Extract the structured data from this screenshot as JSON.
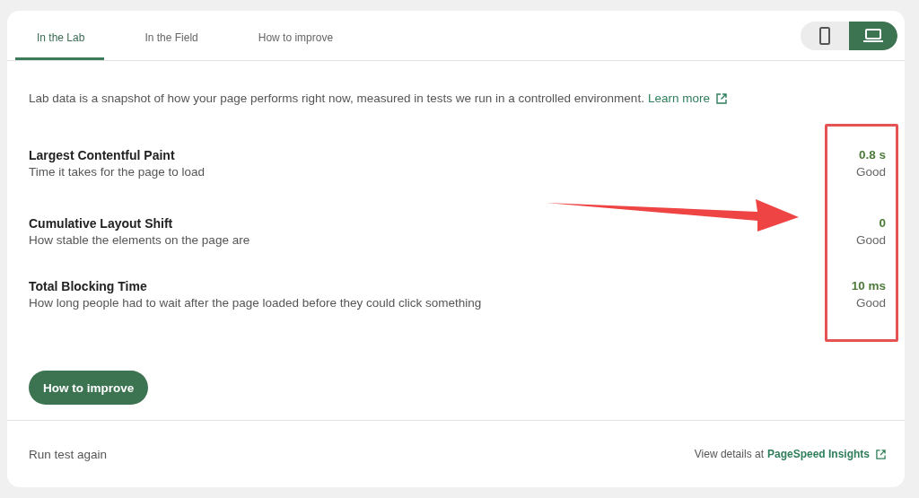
{
  "tabs": [
    {
      "label": "In the Lab",
      "selected": true
    },
    {
      "label": "In the Field",
      "selected": false
    },
    {
      "label": "How to improve",
      "selected": false
    }
  ],
  "device_toggle": [
    {
      "kind": "mobile",
      "selected": false
    },
    {
      "kind": "desktop",
      "selected": true
    }
  ],
  "intro": {
    "text": "Lab data is a snapshot of how your page performs right now, measured in tests we run in a controlled environment.",
    "link": "Learn more"
  },
  "metrics": [
    {
      "name": "Largest Contentful Paint",
      "description": "Time it takes for the page to load",
      "value": "0.8 s",
      "rating": "Good"
    },
    {
      "name": "Cumulative Layout Shift",
      "description": "How stable the elements on the page are",
      "value": "0",
      "rating": "Good"
    },
    {
      "name": "Total Blocking Time",
      "description": "How long people had to wait after the page loaded before they could click something",
      "value": "10 ms",
      "rating": "Good"
    }
  ],
  "improve_button": "How to improve",
  "footer": {
    "run_again": "Run test again",
    "details_prefix": "View details at",
    "details_link": "PageSpeed Insights"
  }
}
